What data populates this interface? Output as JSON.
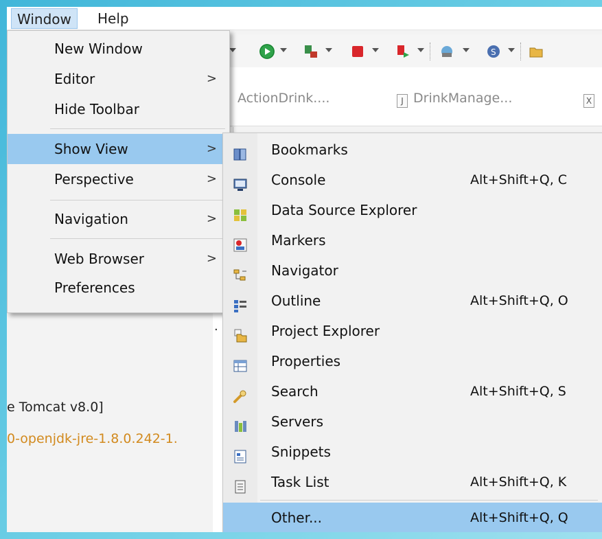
{
  "menubar": {
    "window": "Window",
    "help": "Help"
  },
  "tabs": {
    "tab1": "ActionDrink....",
    "tab2": "DrinkManage...",
    "tab2_icon": "J",
    "tab3_icon": "X"
  },
  "background": {
    "server_label": "e Tomcat v8.0]",
    "jre_path": "0-openjdk-jre-1.8.0.242-1."
  },
  "window_menu": {
    "items": [
      {
        "label": "New Window"
      },
      {
        "label": "Editor",
        "arrow": ">"
      },
      {
        "label": "Hide Toolbar"
      },
      {
        "label": "Show View",
        "arrow": ">"
      },
      {
        "label": "Perspective",
        "arrow": ">"
      },
      {
        "label": "Navigation",
        "arrow": ">"
      },
      {
        "label": "Web Browser",
        "arrow": ">"
      },
      {
        "label": "Preferences"
      }
    ]
  },
  "show_view_menu": {
    "items": [
      {
        "label": "Bookmarks",
        "shortcut": "",
        "icon": "bookmarks-icon"
      },
      {
        "label": "Console",
        "shortcut": "Alt+Shift+Q, C",
        "icon": "console-icon"
      },
      {
        "label": "Data Source Explorer",
        "shortcut": "",
        "icon": "data-source-icon"
      },
      {
        "label": "Markers",
        "shortcut": "",
        "icon": "markers-icon"
      },
      {
        "label": "Navigator",
        "shortcut": "",
        "icon": "navigator-icon"
      },
      {
        "label": "Outline",
        "shortcut": "Alt+Shift+Q, O",
        "icon": "outline-icon"
      },
      {
        "label": "Project Explorer",
        "shortcut": "",
        "icon": "project-explorer-icon"
      },
      {
        "label": "Properties",
        "shortcut": "",
        "icon": "properties-icon"
      },
      {
        "label": "Search",
        "shortcut": "Alt+Shift+Q, S",
        "icon": "search-icon"
      },
      {
        "label": "Servers",
        "shortcut": "",
        "icon": "servers-icon"
      },
      {
        "label": "Snippets",
        "shortcut": "",
        "icon": "snippets-icon"
      },
      {
        "label": "Task List",
        "shortcut": "Alt+Shift+Q, K",
        "icon": "task-list-icon"
      },
      {
        "label": "Other...",
        "shortcut": "Alt+Shift+Q, Q",
        "icon": ""
      }
    ]
  }
}
